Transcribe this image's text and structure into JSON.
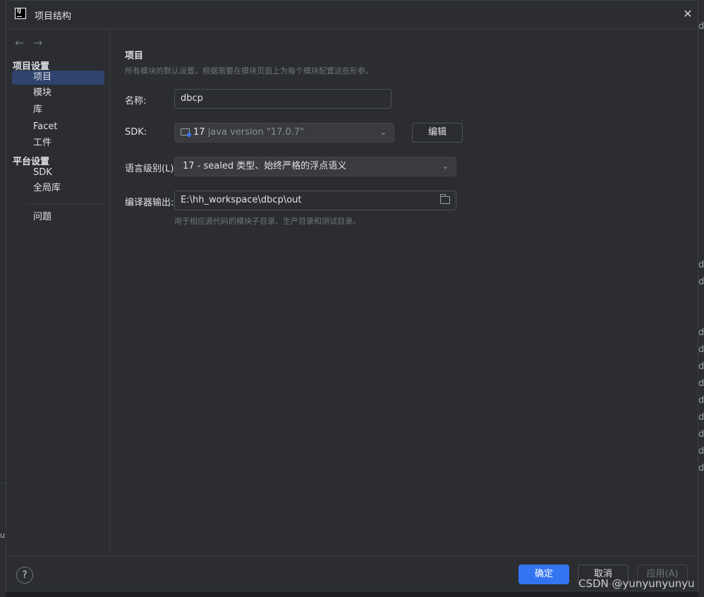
{
  "window": {
    "title": "项目结构",
    "close_icon": "close-icon"
  },
  "sidebar": {
    "back_icon": "←",
    "forward_icon": "→",
    "sections": [
      {
        "title": "项目设置",
        "items": [
          "项目",
          "模块",
          "库",
          "Facet",
          "工件"
        ]
      },
      {
        "title": "平台设置",
        "items": [
          "SDK",
          "全局库"
        ]
      }
    ],
    "problems": "问题",
    "selected": "项目"
  },
  "main": {
    "title": "项目",
    "description": "所有模块的默认设置。根据需要在模块页面上为每个模块配置这些形参。",
    "name_label": "名称:",
    "name_value": "dbcp",
    "sdk_label": "SDK:",
    "sdk_version": "17",
    "sdk_detail": "java version \"17.0.7\"",
    "edit_button": "编辑",
    "language_label": "语言级别(L):",
    "language_value": "17 - sealed 类型、始终严格的浮点语义",
    "compiler_label": "编译器输出:",
    "compiler_value": "E:\\hh_workspace\\dbcp\\out",
    "compiler_hint": "用于相应源代码的模块子目录、生产目录和测试目录。"
  },
  "footer": {
    "help": "?",
    "ok": "确定",
    "cancel": "取消",
    "apply": "应用(A)"
  },
  "watermark": "CSDN @yunyunyunyu",
  "background": {
    "left_char": "u",
    "right_chars": [
      "d",
      "",
      "",
      "",
      "",
      "",
      "",
      "",
      "",
      "",
      "",
      "",
      "",
      "",
      "d",
      "d",
      "d",
      "d",
      "d",
      "d",
      "d",
      "d",
      "d",
      "d",
      "d",
      "d",
      "d"
    ]
  },
  "colors": {
    "accent": "#3574f0",
    "selection": "#2e436e",
    "background": "#2b2d30"
  }
}
